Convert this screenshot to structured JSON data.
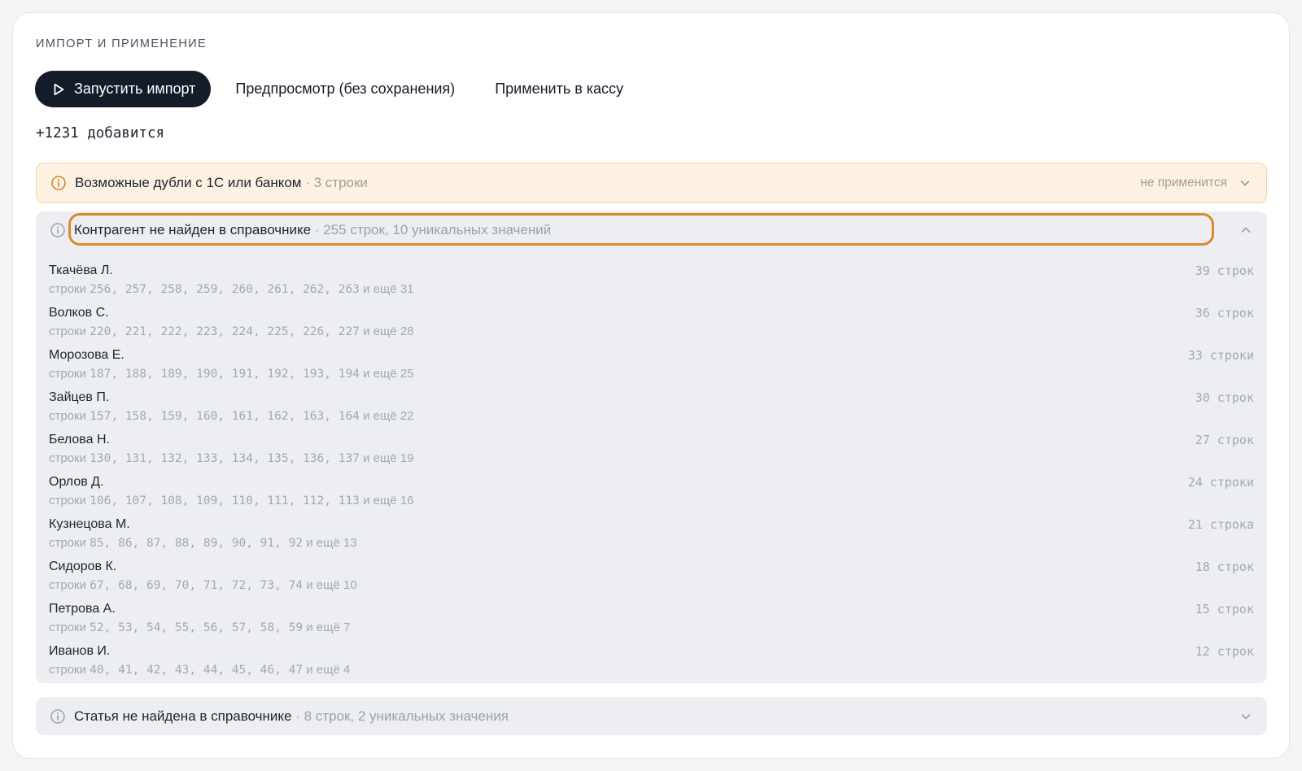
{
  "section": {
    "title": "ИМПОРТ И ПРИМЕНЕНИЕ"
  },
  "toolbar": {
    "run_label": "Запустить импорт",
    "preview_label": "Предпросмотр (без сохранения)",
    "apply_label": "Применить в кассу"
  },
  "summary": {
    "text": "+1231 добавится"
  },
  "groups": {
    "duplicates": {
      "title": "Возможные дубли с 1С или банком",
      "meta": " · 3 строки",
      "status": "не применится",
      "expanded": false
    },
    "counterparty": {
      "title": "Контрагент не найден в справочнике",
      "meta": " · 255 строк, 10 уникальных значений",
      "expanded": true,
      "rows": [
        {
          "name": "Ткачёва Л.",
          "prefix": "строки ",
          "lines": "256, 257, 258, 259, 260, 261, 262, 263",
          "more": " и ещё 31",
          "count": "39 строк"
        },
        {
          "name": "Волков С.",
          "prefix": "строки ",
          "lines": "220, 221, 222, 223, 224, 225, 226, 227",
          "more": " и ещё 28",
          "count": "36 строк"
        },
        {
          "name": "Морозова Е.",
          "prefix": "строки ",
          "lines": "187, 188, 189, 190, 191, 192, 193, 194",
          "more": " и ещё 25",
          "count": "33 строки"
        },
        {
          "name": "Зайцев П.",
          "prefix": "строки ",
          "lines": "157, 158, 159, 160, 161, 162, 163, 164",
          "more": " и ещё 22",
          "count": "30 строк"
        },
        {
          "name": "Белова Н.",
          "prefix": "строки ",
          "lines": "130, 131, 132, 133, 134, 135, 136, 137",
          "more": " и ещё 19",
          "count": "27 строк"
        },
        {
          "name": "Орлов Д.",
          "prefix": "строки ",
          "lines": "106, 107, 108, 109, 110, 111, 112, 113",
          "more": " и ещё 16",
          "count": "24 строки"
        },
        {
          "name": "Кузнецова М.",
          "prefix": "строки ",
          "lines": "85, 86, 87, 88, 89, 90, 91, 92",
          "more": " и ещё 13",
          "count": "21 строка"
        },
        {
          "name": "Сидоров К.",
          "prefix": "строки ",
          "lines": "67, 68, 69, 70, 71, 72, 73, 74",
          "more": " и ещё 10",
          "count": "18 строк"
        },
        {
          "name": "Петрова А.",
          "prefix": "строки ",
          "lines": "52, 53, 54, 55, 56, 57, 58, 59",
          "more": " и ещё 7",
          "count": "15 строк"
        },
        {
          "name": "Иванов И.",
          "prefix": "строки ",
          "lines": "40, 41, 42, 43, 44, 45, 46, 47",
          "more": " и ещё 4",
          "count": "12 строк"
        }
      ]
    },
    "article": {
      "title": "Статья не найдена в справочнике",
      "meta": " · 8 строк, 2 уникальных значения",
      "expanded": false
    }
  },
  "icons": {
    "play": "play-icon",
    "info": "info-icon",
    "chevron_down": "chevron-down-icon",
    "chevron_up": "chevron-up-icon"
  },
  "colors": {
    "primary_button": "#141b29",
    "warning_bg": "#fdf2e1",
    "warning_border": "#f0d5a4",
    "warning_icon": "#d4862a",
    "group_bg": "#eceef2",
    "focus_outline": "#d98a2b"
  }
}
